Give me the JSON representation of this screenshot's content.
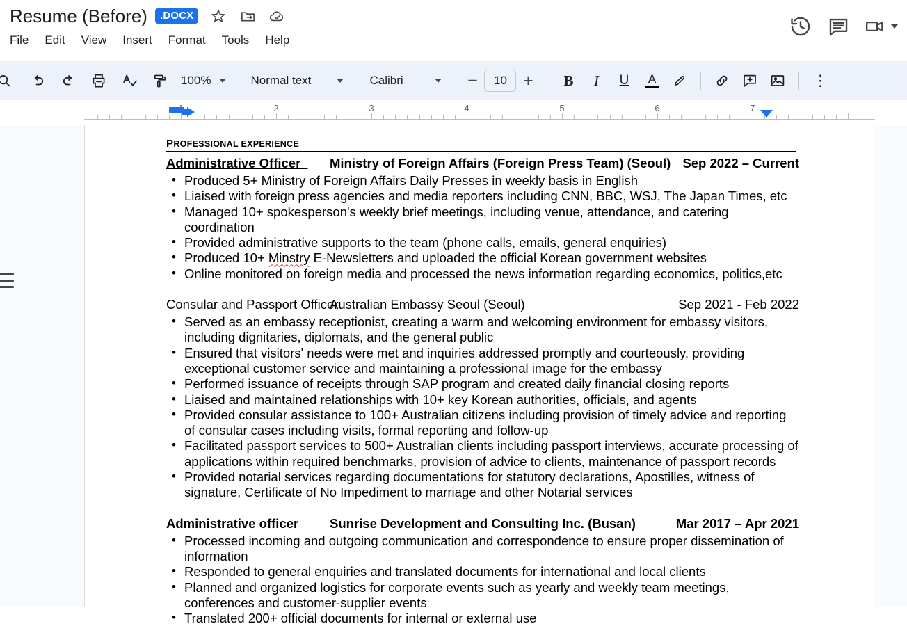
{
  "window": {
    "doc_title": "Resume (Before)",
    "format_badge": ".DOCX"
  },
  "title_icons": [
    {
      "name": "star-icon",
      "glyph": "☆"
    },
    {
      "name": "move-to-folder-icon",
      "glyph": "folder-move"
    },
    {
      "name": "cloud-saved-icon",
      "glyph": "cloud-check"
    }
  ],
  "menu": {
    "items": [
      {
        "label": "File"
      },
      {
        "label": "Edit"
      },
      {
        "label": "View"
      },
      {
        "label": "Insert"
      },
      {
        "label": "Format"
      },
      {
        "label": "Tools"
      },
      {
        "label": "Help"
      }
    ]
  },
  "top_right": {
    "version_history": "version-history-icon",
    "comments": "comment-icon",
    "meet": "video-camera-icon",
    "meet_caret": "chevron-down-icon"
  },
  "toolbar": {
    "search": "search-icon",
    "undo": "undo-icon",
    "redo": "redo-icon",
    "print": "print-icon",
    "spellcheck": "spellcheck-icon",
    "paint_format": "paint-format-icon",
    "zoom_level": "100%",
    "style": "Normal text",
    "font": "Calibri",
    "font_size": "10",
    "minus": "−",
    "plus": "+",
    "bold": "B",
    "italic": "I",
    "underline": "U",
    "text_color": "A",
    "highlight": "highlight-pen-icon",
    "link": "link-icon",
    "add_comment": "add-comment-icon",
    "insert_image": "insert-image-icon",
    "more": "⋮"
  },
  "ruler": {
    "numbers": [
      "1",
      "2",
      "3",
      "4",
      "5",
      "6",
      "7"
    ]
  },
  "document": {
    "section_heading": {
      "first_letter": "P",
      "rest": "ROFESSIONAL EXPERIENCE"
    },
    "jobs": [
      {
        "title": "Administrative Officer",
        "org": "Ministry of Foreign Affairs (Foreign Press Team) (Seoul)",
        "dates": "Sep 2022 – Current",
        "bold": true,
        "bullets": [
          {
            "text": "Produced 5+ Ministry of Foreign Affairs Daily Presses in weekly basis in English"
          },
          {
            "text": "Liaised with foreign press agencies and media reporters including CNN, BBC, WSJ, The Japan Times, etc"
          },
          {
            "text": "Managed 10+ spokesperson's weekly brief meetings, including venue, attendance, and catering coordination"
          },
          {
            "text": "Provided administrative supports to the team (phone calls, emails, general enquiries)"
          },
          {
            "pre": "Produced 10+ ",
            "misspelled": "Minstry",
            "post": " E-Newsletters and uploaded the official Korean government websites"
          },
          {
            "text": "Online monitored on foreign media  and processed the news information regarding economics, politics,etc"
          }
        ]
      },
      {
        "title": "Consular and Passport Officer",
        "org": "Australian Embassy Seoul (Seoul)",
        "dates": "Sep 2021 - Feb 2022",
        "bold": false,
        "bullets": [
          {
            "text": "Served as an embassy receptionist, creating a warm and welcoming environment for embassy visitors, including dignitaries, diplomats, and the general public"
          },
          {
            "text": "Ensured that visitors' needs were met and inquiries addressed promptly and courteously, providing exceptional customer service and maintaining a professional image for the embassy"
          },
          {
            "text": "Performed issuance of receipts through SAP program and created daily financial closing reports"
          },
          {
            "text": "Liaised and maintained relationships with 10+ key Korean authorities, officials, and agents"
          },
          {
            "text": "Provided consular assistance to 100+ Australian citizens including provision of timely advice and reporting of consular cases including visits, formal reporting and follow-up"
          },
          {
            "text": "Facilitated passport services to 500+ Australian clients including passport interviews, accurate processing of applications within required benchmarks, provision of advice to clients, maintenance of passport records"
          },
          {
            "text": "Provided notarial services regarding documentations for statutory declarations, Apostilles, witness of signature, Certificate of No Impediment to marriage and other Notarial services"
          }
        ]
      },
      {
        "title": "Administrative officer",
        "org": "Sunrise Development and Consulting Inc. (Busan)",
        "dates": "Mar 2017 – Apr 2021",
        "bold": true,
        "bullets": [
          {
            "text": "Processed incoming and outgoing communication and correspondence to ensure proper dissemination of information"
          },
          {
            "text": "Responded to general enquiries and translated documents for international and local clients"
          },
          {
            "text": "Planned and organized logistics for corporate events such as yearly and weekly team meetings, conferences and customer-supplier events"
          },
          {
            "text": "Translated 200+ official documents for internal or external use"
          }
        ]
      }
    ]
  },
  "colors": {
    "accent": "#1a73e8",
    "toolbar_bg": "#edf2fa",
    "canvas_bg": "#f8fafd",
    "spell_error": "#e53935"
  }
}
